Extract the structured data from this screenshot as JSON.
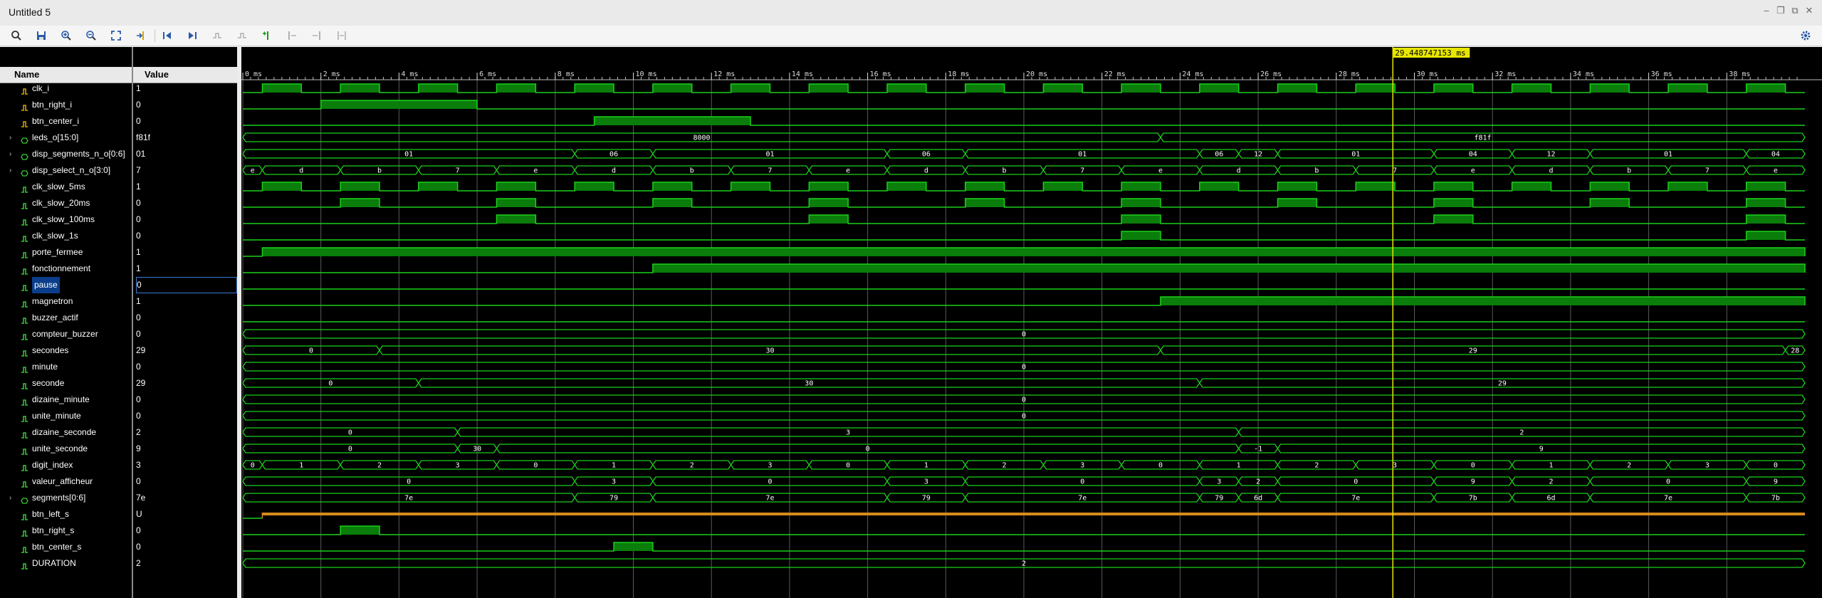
{
  "window": {
    "title": "Untitled 5"
  },
  "toolbar": {
    "icons": [
      "search-icon",
      "save-icon",
      "zoom-in-icon",
      "zoom-out-icon",
      "zoom-fit-icon",
      "go-to-cursor-icon",
      "go-to-first-icon",
      "go-to-last-icon",
      "previous-transition-icon",
      "next-transition-icon",
      "add-marker-icon",
      "previous-marker-icon",
      "next-marker-icon",
      "swap-cursors-icon",
      "settings-icon"
    ]
  },
  "panes": {
    "name_header": "Name",
    "value_header": "Value"
  },
  "cursor": {
    "readout": "29.448747153 ms",
    "time": 29.448747153
  },
  "timeline": {
    "unit": "ms",
    "range": [
      0,
      40
    ],
    "major_ticks": [
      0,
      2,
      4,
      6,
      8,
      10,
      12,
      14,
      16,
      18,
      20,
      22,
      24,
      26,
      28,
      30,
      32,
      34,
      36,
      38
    ],
    "labels": [
      "0 ms",
      "2 ms",
      "4 ms",
      "6 ms",
      "8 ms",
      "10 ms",
      "12 ms",
      "14 ms",
      "16 ms",
      "18 ms",
      "20 ms",
      "22 ms",
      "24 ms",
      "26 ms",
      "28 ms",
      "30 ms",
      "32 ms",
      "34 ms",
      "36 ms",
      "38 ms"
    ]
  },
  "signals": [
    {
      "name": "clk_i",
      "value": "1",
      "kind": "in-bit",
      "type": "clock",
      "period": 2,
      "high": 1,
      "start": 0.5
    },
    {
      "name": "btn_right_i",
      "value": "0",
      "kind": "in-bit",
      "type": "bit",
      "pulses": [
        [
          2,
          6
        ]
      ]
    },
    {
      "name": "btn_center_i",
      "value": "0",
      "kind": "in-bit",
      "type": "bit",
      "pulses": [
        [
          9,
          13
        ]
      ]
    },
    {
      "name": "leds_o[15:0]",
      "value": "f81f",
      "kind": "bus",
      "expand": true,
      "type": "bus",
      "segments": [
        [
          0,
          23.5,
          "8000"
        ],
        [
          23.5,
          40,
          "f81f"
        ]
      ]
    },
    {
      "name": "disp_segments_n_o[0:6]",
      "value": "01",
      "kind": "bus",
      "expand": true,
      "type": "bus",
      "segments": [
        [
          0,
          8.5,
          "01"
        ],
        [
          8.5,
          10.5,
          "06"
        ],
        [
          10.5,
          16.5,
          "01"
        ],
        [
          16.5,
          18.5,
          "06"
        ],
        [
          18.5,
          24.5,
          "01"
        ],
        [
          24.5,
          25.5,
          "06"
        ],
        [
          25.5,
          26.5,
          "12"
        ],
        [
          26.5,
          30.5,
          "01"
        ],
        [
          30.5,
          32.5,
          "04"
        ],
        [
          32.5,
          34.5,
          "12"
        ],
        [
          34.5,
          38.5,
          "01"
        ],
        [
          38.5,
          40,
          "04"
        ]
      ]
    },
    {
      "name": "disp_select_n_o[3:0]",
      "value": "7",
      "kind": "bus",
      "expand": true,
      "type": "bus",
      "segments": [
        [
          0,
          0.5,
          "e"
        ],
        [
          0.5,
          2.5,
          "d"
        ],
        [
          2.5,
          4.5,
          "b"
        ],
        [
          4.5,
          6.5,
          "7"
        ],
        [
          6.5,
          8.5,
          "e"
        ],
        [
          8.5,
          10.5,
          "d"
        ],
        [
          10.5,
          12.5,
          "b"
        ],
        [
          12.5,
          14.5,
          "7"
        ],
        [
          14.5,
          16.5,
          "e"
        ],
        [
          16.5,
          18.5,
          "d"
        ],
        [
          18.5,
          20.5,
          "b"
        ],
        [
          20.5,
          22.5,
          "7"
        ],
        [
          22.5,
          24.5,
          "e"
        ],
        [
          24.5,
          26.5,
          "d"
        ],
        [
          26.5,
          28.5,
          "b"
        ],
        [
          28.5,
          30.5,
          "7"
        ],
        [
          30.5,
          32.5,
          "e"
        ],
        [
          32.5,
          34.5,
          "d"
        ],
        [
          34.5,
          36.5,
          "b"
        ],
        [
          36.5,
          38.5,
          "7"
        ],
        [
          38.5,
          40,
          "e"
        ]
      ]
    },
    {
      "name": "clk_slow_5ms",
      "value": "1",
      "kind": "sig",
      "type": "bit",
      "pulses": [
        [
          0.5,
          1.5
        ],
        [
          2.5,
          3.5
        ],
        [
          4.5,
          5.5
        ],
        [
          6.5,
          7.5
        ],
        [
          8.5,
          9.5
        ],
        [
          10.5,
          11.5
        ],
        [
          12.5,
          13.5
        ],
        [
          14.5,
          15.5
        ],
        [
          16.5,
          17.5
        ],
        [
          18.5,
          19.5
        ],
        [
          20.5,
          21.5
        ],
        [
          22.5,
          23.5
        ],
        [
          24.5,
          25.5
        ],
        [
          26.5,
          27.5
        ],
        [
          28.5,
          29.5
        ],
        [
          30.5,
          31.5
        ],
        [
          32.5,
          33.5
        ],
        [
          34.5,
          35.5
        ],
        [
          36.5,
          37.5
        ],
        [
          38.5,
          39.5
        ]
      ]
    },
    {
      "name": "clk_slow_20ms",
      "value": "0",
      "kind": "sig",
      "type": "bit",
      "pulses": [
        [
          2.5,
          3.5
        ],
        [
          6.5,
          7.5
        ],
        [
          10.5,
          11.5
        ],
        [
          14.5,
          15.5
        ],
        [
          18.5,
          19.5
        ],
        [
          22.5,
          23.5
        ],
        [
          26.5,
          27.5
        ],
        [
          30.5,
          31.5
        ],
        [
          34.5,
          35.5
        ],
        [
          38.5,
          39.5
        ]
      ]
    },
    {
      "name": "clk_slow_100ms",
      "value": "0",
      "kind": "sig",
      "type": "bit",
      "pulses": [
        [
          6.5,
          7.5
        ],
        [
          14.5,
          15.5
        ],
        [
          22.5,
          23.5
        ],
        [
          30.5,
          31.5
        ],
        [
          38.5,
          39.5
        ]
      ]
    },
    {
      "name": "clk_slow_1s",
      "value": "0",
      "kind": "sig",
      "type": "bit",
      "pulses": [
        [
          22.5,
          23.5
        ],
        [
          38.5,
          39.5
        ]
      ]
    },
    {
      "name": "porte_fermee",
      "value": "1",
      "kind": "sig",
      "type": "bit",
      "pulses": [
        [
          0.5,
          40
        ]
      ]
    },
    {
      "name": "fonctionnement",
      "value": "1",
      "kind": "sig",
      "type": "bit",
      "pulses": [
        [
          10.5,
          40
        ]
      ]
    },
    {
      "name": "pause",
      "value": "0",
      "kind": "sig",
      "selected": true,
      "type": "bit",
      "pulses": []
    },
    {
      "name": "magnetron",
      "value": "1",
      "kind": "sig",
      "type": "bit",
      "pulses": [
        [
          23.5,
          40
        ]
      ]
    },
    {
      "name": "buzzer_actif",
      "value": "0",
      "kind": "sig",
      "type": "bit",
      "pulses": []
    },
    {
      "name": "compteur_buzzer",
      "value": "0",
      "kind": "sig",
      "type": "bus",
      "segments": [
        [
          0,
          40,
          "0"
        ]
      ]
    },
    {
      "name": "secondes",
      "value": "29",
      "kind": "sig",
      "type": "bus",
      "segments": [
        [
          0,
          3.5,
          "0"
        ],
        [
          3.5,
          23.5,
          "30"
        ],
        [
          23.5,
          39.5,
          "29"
        ],
        [
          39.5,
          40,
          "28"
        ]
      ]
    },
    {
      "name": "minute",
      "value": "0",
      "kind": "sig",
      "type": "bus",
      "segments": [
        [
          0,
          40,
          "0"
        ]
      ]
    },
    {
      "name": "seconde",
      "value": "29",
      "kind": "sig",
      "type": "bus",
      "segments": [
        [
          0,
          4.5,
          "0"
        ],
        [
          4.5,
          24.5,
          "30"
        ],
        [
          24.5,
          40,
          "29"
        ]
      ]
    },
    {
      "name": "dizaine_minute",
      "value": "0",
      "kind": "sig",
      "type": "bus",
      "segments": [
        [
          0,
          40,
          "0"
        ]
      ]
    },
    {
      "name": "unite_minute",
      "value": "0",
      "kind": "sig",
      "type": "bus",
      "segments": [
        [
          0,
          40,
          "0"
        ]
      ]
    },
    {
      "name": "dizaine_seconde",
      "value": "2",
      "kind": "sig",
      "type": "bus",
      "segments": [
        [
          0,
          5.5,
          "0"
        ],
        [
          5.5,
          25.5,
          "3"
        ],
        [
          25.5,
          40,
          "2"
        ]
      ]
    },
    {
      "name": "unite_seconde",
      "value": "9",
      "kind": "sig",
      "type": "bus",
      "segments": [
        [
          0,
          5.5,
          "0"
        ],
        [
          5.5,
          6.5,
          "30"
        ],
        [
          6.5,
          25.5,
          "0"
        ],
        [
          25.5,
          26.5,
          "-1"
        ],
        [
          26.5,
          40,
          "9"
        ]
      ]
    },
    {
      "name": "digit_index",
      "value": "3",
      "kind": "sig",
      "type": "bus",
      "segments": [
        [
          0,
          0.5,
          "0"
        ],
        [
          0.5,
          2.5,
          "1"
        ],
        [
          2.5,
          4.5,
          "2"
        ],
        [
          4.5,
          6.5,
          "3"
        ],
        [
          6.5,
          8.5,
          "0"
        ],
        [
          8.5,
          10.5,
          "1"
        ],
        [
          10.5,
          12.5,
          "2"
        ],
        [
          12.5,
          14.5,
          "3"
        ],
        [
          14.5,
          16.5,
          "0"
        ],
        [
          16.5,
          18.5,
          "1"
        ],
        [
          18.5,
          20.5,
          "2"
        ],
        [
          20.5,
          22.5,
          "3"
        ],
        [
          22.5,
          24.5,
          "0"
        ],
        [
          24.5,
          26.5,
          "1"
        ],
        [
          26.5,
          28.5,
          "2"
        ],
        [
          28.5,
          30.5,
          "3"
        ],
        [
          30.5,
          32.5,
          "0"
        ],
        [
          32.5,
          34.5,
          "1"
        ],
        [
          34.5,
          36.5,
          "2"
        ],
        [
          36.5,
          38.5,
          "3"
        ],
        [
          38.5,
          40,
          "0"
        ]
      ]
    },
    {
      "name": "valeur_afficheur",
      "value": "0",
      "kind": "sig",
      "type": "bus",
      "segments": [
        [
          0,
          8.5,
          "0"
        ],
        [
          8.5,
          10.5,
          "3"
        ],
        [
          10.5,
          16.5,
          "0"
        ],
        [
          16.5,
          18.5,
          "3"
        ],
        [
          18.5,
          24.5,
          "0"
        ],
        [
          24.5,
          25.5,
          "3"
        ],
        [
          25.5,
          26.5,
          "2"
        ],
        [
          26.5,
          30.5,
          "0"
        ],
        [
          30.5,
          32.5,
          "9"
        ],
        [
          32.5,
          34.5,
          "2"
        ],
        [
          34.5,
          38.5,
          "0"
        ],
        [
          38.5,
          40,
          "9"
        ]
      ]
    },
    {
      "name": "segments[0:6]",
      "value": "7e",
      "kind": "bus",
      "expand": true,
      "type": "bus",
      "segments": [
        [
          0,
          8.5,
          "7e"
        ],
        [
          8.5,
          10.5,
          "79"
        ],
        [
          10.5,
          16.5,
          "7e"
        ],
        [
          16.5,
          18.5,
          "79"
        ],
        [
          18.5,
          24.5,
          "7e"
        ],
        [
          24.5,
          25.5,
          "79"
        ],
        [
          25.5,
          26.5,
          "6d"
        ],
        [
          26.5,
          30.5,
          "7e"
        ],
        [
          30.5,
          32.5,
          "7b"
        ],
        [
          32.5,
          34.5,
          "6d"
        ],
        [
          34.5,
          38.5,
          "7e"
        ],
        [
          38.5,
          40,
          "7b"
        ]
      ]
    },
    {
      "name": "btn_left_s",
      "value": "U",
      "kind": "sig",
      "type": "undef",
      "start": 0.5
    },
    {
      "name": "btn_right_s",
      "value": "0",
      "kind": "sig",
      "type": "bit",
      "pulses": [
        [
          2.5,
          3.5
        ]
      ]
    },
    {
      "name": "btn_center_s",
      "value": "0",
      "kind": "sig",
      "type": "bit",
      "pulses": [
        [
          9.5,
          10.5
        ]
      ]
    },
    {
      "name": "DURATION",
      "value": "2",
      "kind": "sig",
      "type": "bus",
      "segments": [
        [
          0,
          40,
          "2"
        ]
      ]
    }
  ],
  "colors": {
    "wave": "#1bd01b",
    "wave_fill": "#0a7d0a",
    "cursor": "#e6e600",
    "undef": "#d88a1c",
    "grid": "#5a5a5a",
    "bus_text": "#ffffff"
  }
}
